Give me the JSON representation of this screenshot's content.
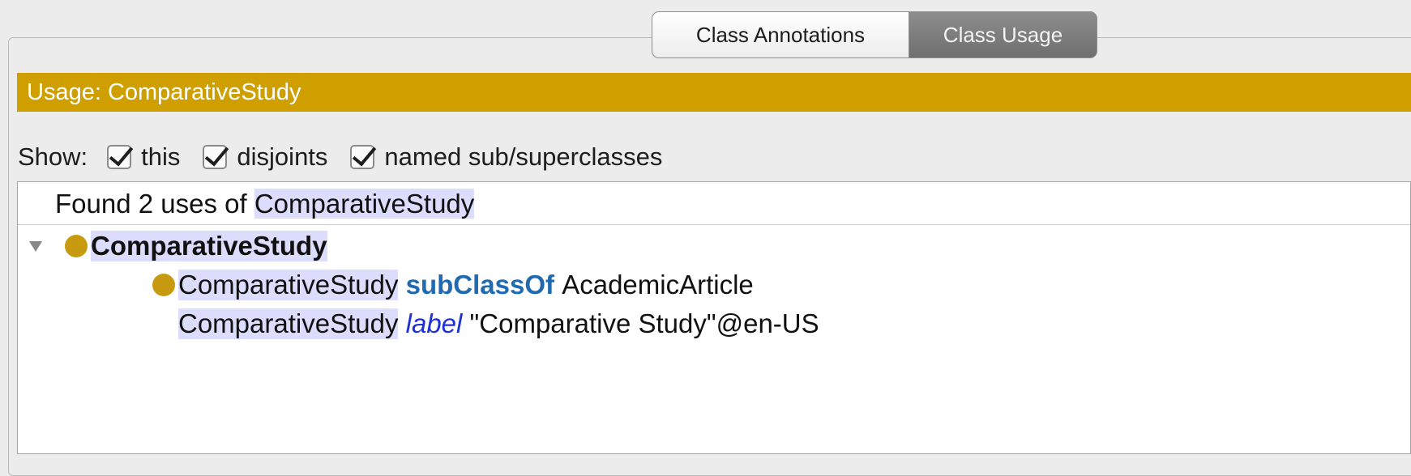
{
  "tabs": {
    "annotations": "Class Annotations",
    "usage": "Class Usage"
  },
  "header": {
    "title": "Usage: ComparativeStudy"
  },
  "show": {
    "label": "Show:",
    "options": [
      {
        "label": "this",
        "checked": true
      },
      {
        "label": "disjoints",
        "checked": true
      },
      {
        "label": "named sub/superclasses",
        "checked": true
      }
    ]
  },
  "results": {
    "found_prefix": "Found 2 uses of ",
    "found_entity": "ComparativeStudy",
    "root": "ComparativeStudy",
    "axiom1": {
      "subject": "ComparativeStudy",
      "keyword": "subClassOf",
      "object": "AcademicArticle"
    },
    "axiom2": {
      "subject": "ComparativeStudy",
      "keyword": "label",
      "object": "\"Comparative Study\"@en-US"
    }
  },
  "colors": {
    "header_bg": "#cf9f00",
    "highlight": "#dcdcfc",
    "class_dot": "#c89a10",
    "keyword": "#1f6ab0",
    "label_keyword": "#1f2fd8"
  },
  "icons": [
    "disclosure-triangle-icon",
    "class-icon",
    "checkbox-icon"
  ]
}
